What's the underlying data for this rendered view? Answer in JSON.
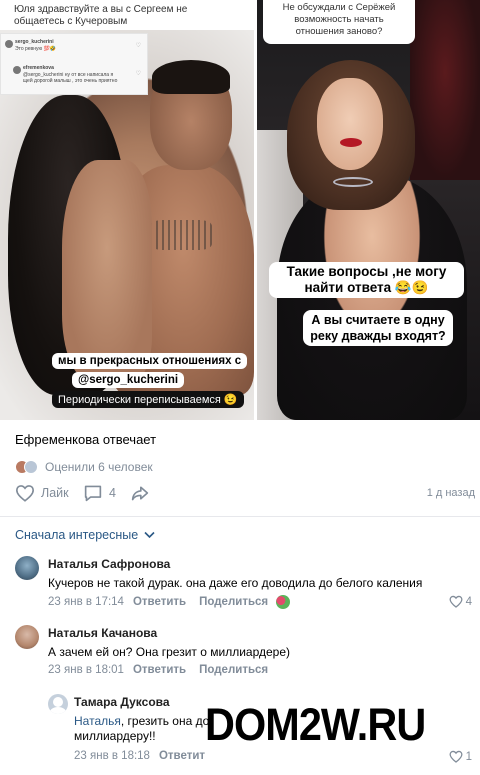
{
  "stories": {
    "left": {
      "question": "Юля здравствуйте а вы с Сергеем не общаетесь с Кучеровым",
      "comment_user": "sergo_kucherini",
      "comment_text": "Это ревную 💯🤣",
      "reply_user": "efremenkova",
      "reply_text": "@sergo_kucherini ну от все написала я щей дорогой малыш , это очень приятно",
      "sticker_1": "мы в прекрасных отношениях с",
      "sticker_2": "@sergo_kucherini",
      "sticker_3": "Периодически переписываемся 😉"
    },
    "right": {
      "question": "Не обсуждали с Серёжей возможность начать отношения заново?",
      "sticker_1": "Такие вопросы ,не могу найти ответа 😂😉",
      "sticker_2": "А вы считаете в одну реку дважды входят?"
    }
  },
  "post": {
    "text": "Ефременкова отвечает",
    "rating_label": "Оценили 6 человек",
    "like_label": "Лайк",
    "comment_count": "4",
    "time_ago": "1 д назад",
    "icons": [
      "heart-icon",
      "comment-icon",
      "share-icon"
    ]
  },
  "comments_section": {
    "sort_label": "Сначала интересные",
    "comments": [
      {
        "name": "Наталья Сафронова",
        "text": "Кучеров не такой дурак. она даже его доводила до белого каления",
        "date": "23 янв в 17:14",
        "reply_label": "Ответить",
        "share_label": "Поделиться",
        "likes": "4"
      },
      {
        "name": "Наталья Качанова",
        "text": "А зачем ей он? Она грезит о миллиардере)",
        "date": "23 янв в 18:01",
        "reply_label": "Ответить",
        "share_label": "Поделиться"
      }
    ],
    "reply": {
      "name": "Тамара Дуксова",
      "mention": "Наталья",
      "text_line1": ", грезить она до",
      "text_line2": "миллиардеру!!",
      "date": "23 янв в 18:18",
      "reply_label": "Ответит",
      "likes": "1"
    }
  },
  "watermark": "DOM2W.RU",
  "colors": {
    "link": "#2a5885",
    "muted": "#818c99",
    "separator": "#e7e8ec"
  }
}
